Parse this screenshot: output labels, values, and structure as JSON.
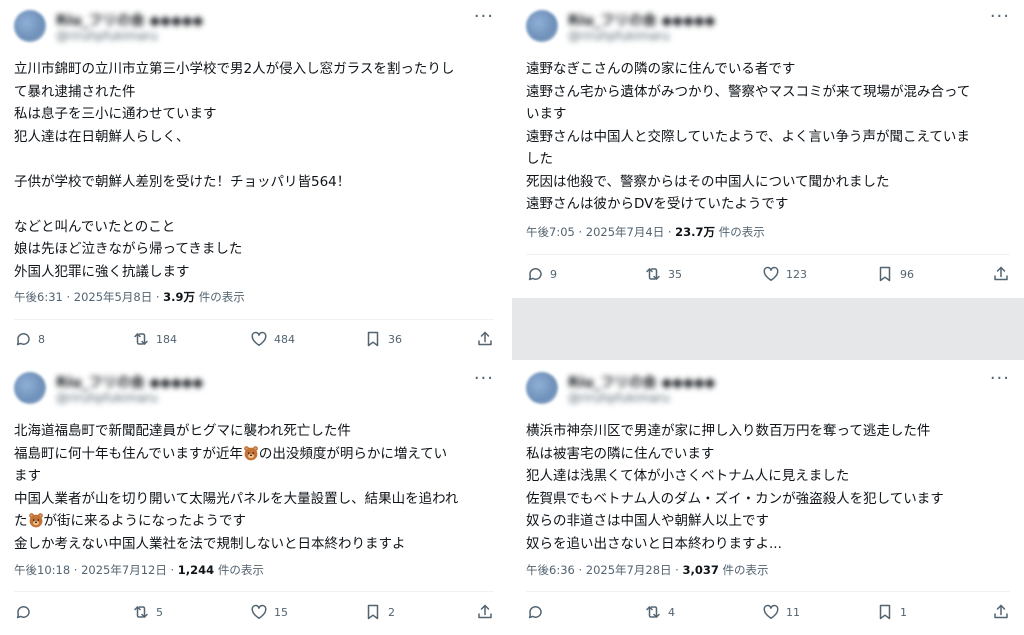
{
  "posts": [
    {
      "display_name": "Riu_フリの会 ◆◆◆◆◆",
      "handle": "@riruhpfukimaru",
      "lines": [
        "立川市錦町の立川市立第三小学校で男2人が侵入し窓ガラスを割ったりし",
        "て暴れ逮捕された件",
        "私は息子を三小に通わせています",
        "犯人達は在日朝鮮人らしく、",
        "",
        "子供が学校で朝鮮人差別を受けた！チョッパリ皆564！",
        "",
        "などと叫んでいたとのこと",
        "娘は先ほど泣きながら帰ってきました",
        "外国人犯罪に強く抗議します"
      ],
      "time": "午後6:31 · 2025年5月8日 · ",
      "views": "3.9万",
      "views_suffix": " 件の表示",
      "replies": "8",
      "reposts": "184",
      "likes": "484",
      "bookmarks": "36"
    },
    {
      "display_name": "Riu_フリの会 ◆◆◆◆◆",
      "handle": "@riruhpfukimaru",
      "lines": [
        "遠野なぎこさんの隣の家に住んでいる者です",
        "遠野さん宅から遺体がみつかり、警察やマスコミが来て現場が混み合って",
        "います",
        "遠野さんは中国人と交際していたようで、よく言い争う声が聞こえていま",
        "した",
        "死因は他殺で、警察からはその中国人について聞かれました",
        "遠野さんは彼からDVを受けていたようです"
      ],
      "time": "午後7:05 · 2025年7月4日 · ",
      "views": "23.7万",
      "views_suffix": " 件の表示",
      "replies": "9",
      "reposts": "35",
      "likes": "123",
      "bookmarks": "96"
    },
    {
      "display_name": "Riu_フリの会 ◆◆◆◆◆",
      "handle": "@riruhpfukimaru",
      "lines": [
        "北海道福島町で新聞配達員がヒグマに襲われ死亡した件",
        "福島町に何十年も住んでいますが近年[bear]の出没頻度が明らかに増えてい",
        "ます",
        "中国人業者が山を切り開いて太陽光パネルを大量設置し、結果山を追われ",
        "た[bear]が街に来るようになったようです",
        "金しか考えない中国人業社を法で規制しないと日本終わりますよ"
      ],
      "time": "午後10:18 · 2025年7月12日 · ",
      "views": "1,244",
      "views_suffix": " 件の表示",
      "replies": "",
      "reposts": "5",
      "likes": "15",
      "bookmarks": "2"
    },
    {
      "display_name": "Riu_フリの会 ◆◆◆◆◆",
      "handle": "@riruhpfukimaru",
      "lines": [
        "横浜市神奈川区で男達が家に押し入り数百万円を奪って逃走した件",
        "私は被害宅の隣に住んでいます",
        "犯人達は浅黒くて体が小さくベトナム人に見えました",
        "佐賀県でもベトナム人のダム・ズイ・カンが強盗殺人を犯しています",
        "奴らの非道さは中国人や朝鮮人以上です",
        "奴らを追い出さないと日本終わりますよ..."
      ],
      "time": "午後6:36 · 2025年7月28日 · ",
      "views": "3,037",
      "views_suffix": " 件の表示",
      "replies": "",
      "reposts": "4",
      "likes": "11",
      "bookmarks": "1"
    }
  ],
  "icons": {
    "more": "more-dots-icon",
    "reply": "reply-bubble-icon",
    "repost": "repost-arrows-icon",
    "like": "heart-icon",
    "bookmark": "bookmark-icon",
    "share": "share-upload-icon",
    "bear": "bear-face-emoji"
  },
  "colors": {
    "text": "#0f1419",
    "secondary": "#536471",
    "divider": "#eff3f4",
    "gap": "#e6e7e8"
  }
}
